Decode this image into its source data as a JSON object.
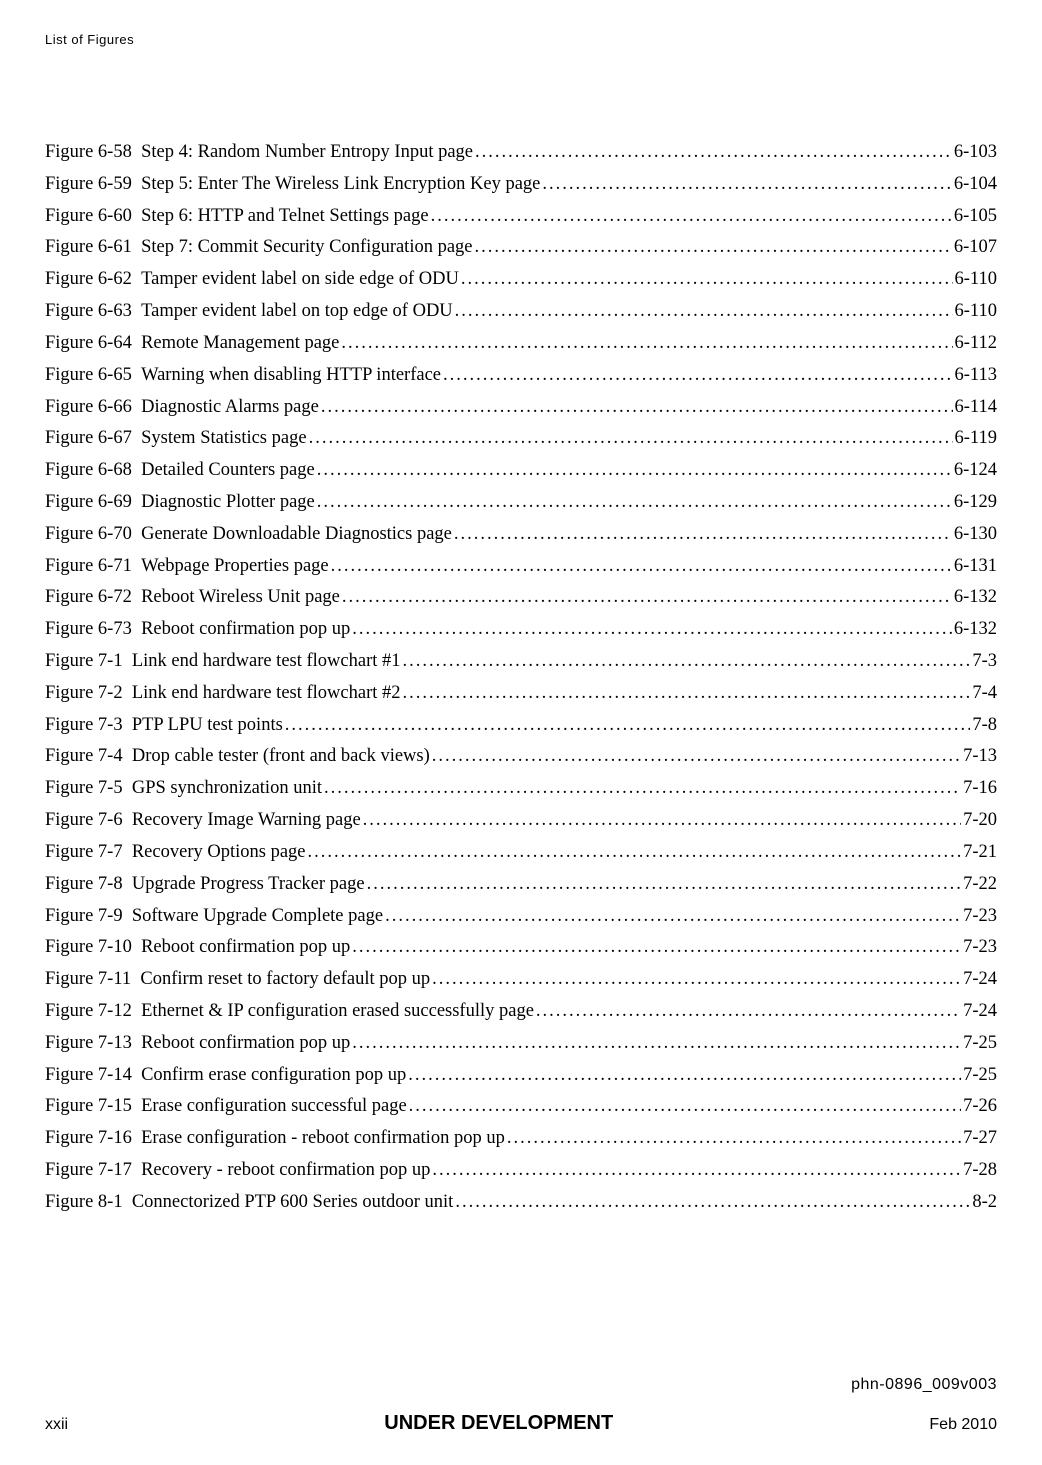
{
  "header": "List of Figures",
  "entries": [
    {
      "label": "Figure 6-58",
      "title": "Step 4: Random Number Entropy Input page",
      "page": "6-103"
    },
    {
      "label": "Figure 6-59",
      "title": "Step 5: Enter The Wireless Link Encryption Key page",
      "page": "6-104"
    },
    {
      "label": "Figure 6-60",
      "title": "Step 6: HTTP and Telnet Settings page",
      "page": "6-105"
    },
    {
      "label": "Figure 6-61",
      "title": "Step 7: Commit Security Configuration page",
      "page": "6-107"
    },
    {
      "label": "Figure 6-62",
      "title": "Tamper evident label on side edge of ODU",
      "page": "6-110"
    },
    {
      "label": "Figure 6-63",
      "title": "Tamper evident label on top edge of ODU",
      "page": "6-110"
    },
    {
      "label": "Figure 6-64",
      "title": "Remote Management page",
      "page": "6-112"
    },
    {
      "label": "Figure 6-65",
      "title": "Warning when disabling HTTP interface",
      "page": "6-113"
    },
    {
      "label": "Figure 6-66",
      "title": "Diagnostic Alarms page",
      "page": "6-114"
    },
    {
      "label": "Figure 6-67",
      "title": "System Statistics page",
      "page": "6-119"
    },
    {
      "label": "Figure 6-68",
      "title": "Detailed Counters page",
      "page": "6-124"
    },
    {
      "label": "Figure 6-69",
      "title": "Diagnostic Plotter page",
      "page": "6-129"
    },
    {
      "label": "Figure 6-70",
      "title": "Generate Downloadable Diagnostics page",
      "page": "6-130"
    },
    {
      "label": "Figure 6-71",
      "title": "Webpage Properties page",
      "page": "6-131"
    },
    {
      "label": "Figure 6-72",
      "title": "Reboot Wireless Unit page",
      "page": "6-132"
    },
    {
      "label": "Figure 6-73",
      "title": "Reboot confirmation pop up",
      "page": "6-132"
    },
    {
      "label": "Figure 7-1",
      "title": "Link end hardware test flowchart #1",
      "page": "7-3"
    },
    {
      "label": "Figure 7-2",
      "title": "Link end hardware test flowchart #2",
      "page": "7-4"
    },
    {
      "label": "Figure 7-3",
      "title": "PTP LPU test points",
      "page": "7-8"
    },
    {
      "label": "Figure 7-4",
      "title": "Drop cable tester (front and back views)",
      "page": "7-13"
    },
    {
      "label": "Figure 7-5",
      "title": "GPS synchronization unit",
      "page": "7-16"
    },
    {
      "label": "Figure 7-6",
      "title": "Recovery Image Warning page",
      "page": "7-20"
    },
    {
      "label": "Figure 7-7",
      "title": "Recovery Options page",
      "page": "7-21"
    },
    {
      "label": "Figure 7-8",
      "title": "Upgrade Progress Tracker page",
      "page": "7-22"
    },
    {
      "label": "Figure 7-9",
      "title": "Software Upgrade Complete page",
      "page": "7-23"
    },
    {
      "label": "Figure 7-10",
      "title": "Reboot confirmation pop up",
      "page": "7-23"
    },
    {
      "label": "Figure 7-11",
      "title": "Confirm reset to factory default pop up",
      "page": "7-24"
    },
    {
      "label": "Figure 7-12",
      "title": "Ethernet & IP configuration erased successfully page",
      "page": "7-24"
    },
    {
      "label": "Figure 7-13",
      "title": "Reboot confirmation pop up",
      "page": "7-25"
    },
    {
      "label": "Figure 7-14",
      "title": "Confirm erase configuration pop up",
      "page": "7-25"
    },
    {
      "label": "Figure 7-15",
      "title": "Erase configuration successful page",
      "page": "7-26"
    },
    {
      "label": "Figure 7-16",
      "title": "Erase configuration - reboot confirmation pop up",
      "page": "7-27"
    },
    {
      "label": "Figure 7-17",
      "title": "Recovery - reboot confirmation pop up",
      "page": "7-28"
    },
    {
      "label": "Figure 8-1",
      "title": "Connectorized PTP 600 Series outdoor unit",
      "page": "8-2"
    }
  ],
  "footer": {
    "doc_id": "phn-0896_009v003",
    "page_num": "xxii",
    "status": "UNDER DEVELOPMENT",
    "date": "Feb 2010"
  }
}
